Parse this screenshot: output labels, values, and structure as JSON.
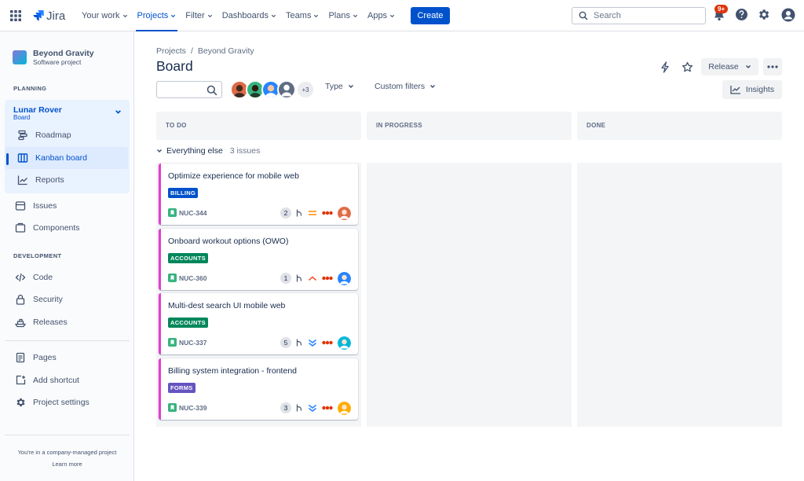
{
  "nav": {
    "logo": "Jira",
    "items": [
      {
        "label": "Your work",
        "active": false
      },
      {
        "label": "Projects",
        "active": true
      },
      {
        "label": "Filter",
        "active": false
      },
      {
        "label": "Dashboards",
        "active": false
      },
      {
        "label": "Teams",
        "active": false
      },
      {
        "label": "Plans",
        "active": false
      },
      {
        "label": "Apps",
        "active": false
      }
    ],
    "create_label": "Create",
    "search_placeholder": "Search",
    "notification_badge": "9+"
  },
  "sidebar": {
    "project_name": "Beyond Gravity",
    "project_type": "Software project",
    "planning_label": "PLANNING",
    "board_name": "Lunar Rover",
    "board_sub": "Board",
    "board_items": [
      "Roadmap",
      "Kanban board",
      "Reports"
    ],
    "other_items": [
      "Issues",
      "Components"
    ],
    "development_label": "DEVELOPMENT",
    "dev_items": [
      "Code",
      "Security",
      "Releases"
    ],
    "bottom_items": [
      "Pages",
      "Add shortcut",
      "Project settings"
    ],
    "footer_note": "You're in a company-managed project",
    "learn_more": "Learn more"
  },
  "main": {
    "breadcrumb": [
      "Projects",
      "Beyond Gravity"
    ],
    "title": "Board",
    "release_label": "Release",
    "avatars_more": "+3",
    "type_filter": "Type",
    "custom_filters": "Custom filters",
    "insights_label": "Insights",
    "columns": [
      "TO DO",
      "IN PROGRESS",
      "DONE"
    ],
    "swimlane": {
      "label": "Everything else",
      "count": "3 issues"
    }
  },
  "cards": [
    {
      "title": "Optimize experience for mobile web",
      "label": "BILLING",
      "label_color": "#0052cc",
      "key": "NUC-344",
      "estimate": "2",
      "priority": "medium",
      "assignee_color": "#de6b48"
    },
    {
      "title": "Onboard workout options (OWO)",
      "label": "ACCOUNTS",
      "label_color": "#00875a",
      "key": "NUC-360",
      "estimate": "1",
      "priority": "high",
      "assignee_color": "#2684ff"
    },
    {
      "title": "Multi-dest search UI mobile web",
      "label": "ACCOUNTS",
      "label_color": "#00875a",
      "key": "NUC-337",
      "estimate": "5",
      "priority": "lowest",
      "assignee_color": "#00b8d9"
    },
    {
      "title": "Billing system integration - frontend",
      "label": "FORMS",
      "label_color": "#6554c0",
      "key": "NUC-339",
      "estimate": "3",
      "priority": "lowest",
      "assignee_color": "#ffab00"
    }
  ]
}
